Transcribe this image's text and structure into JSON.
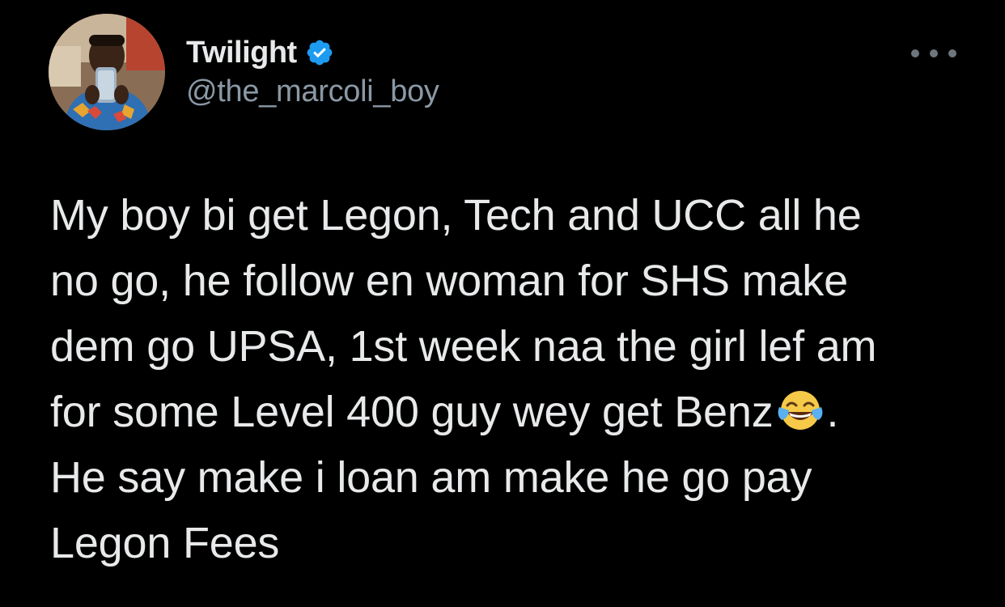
{
  "author": {
    "display_name": "Twilight",
    "handle": "@the_marcoli_boy",
    "verified": true,
    "avatar_icon": "user-photo-avatar",
    "verified_icon": "verified-badge-icon"
  },
  "menu": {
    "icon": "more-options-icon"
  },
  "tweet": {
    "lines": [
      "My boy bi get Legon, Tech and UCC all he",
      "no go, he follow en woman for SHS make",
      "dem go UPSA, 1st week naa the girl lef am",
      "for some Level 400 guy wey get Benz",
      ".",
      "He say make i loan am make he go pay",
      "Legon Fees"
    ],
    "emoji_icon": "face-with-tears-of-joy-emoji"
  },
  "colors": {
    "background": "#000000",
    "text": "#e7e9ea",
    "secondary": "#8b98a5",
    "verified_blue": "#1d9bf0"
  }
}
